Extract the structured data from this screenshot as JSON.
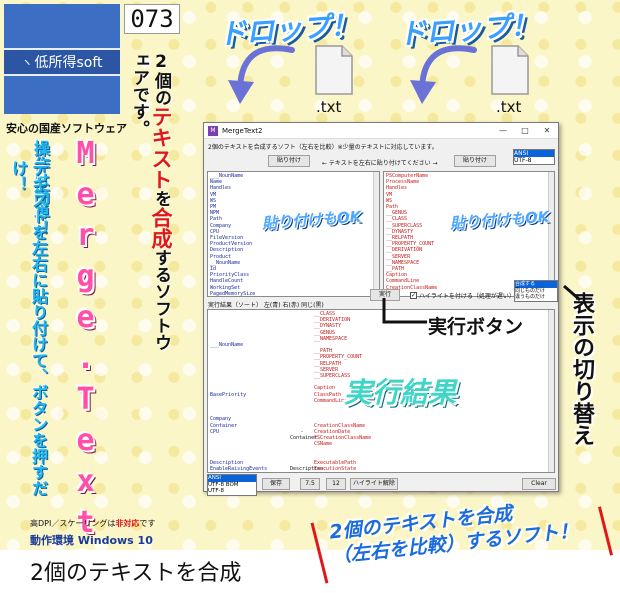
{
  "logo": {
    "mark": "ヽ",
    "name": "低所得soft"
  },
  "tagline": "安心の国産ソフトウェア",
  "number": "073",
  "drop1": "ドロップ！",
  "drop2": "ドロップ！",
  "file1": ".txt",
  "file2": ".txt",
  "vertical": {
    "desc": {
      "p1": "2個の",
      "red1": "テキスト",
      "p2": "を",
      "red2": "合成",
      "p3": "するソフトウェアです。"
    },
    "op1": "操作は簡単！",
    "op2": "テキストを左右に貼り付けて、ボタンを押すだけ！",
    "title": "Merge.Text2",
    "display": "表示の切り替え"
  },
  "hdpi": {
    "pre": "高DPI／スケーリングは",
    "red": "非対応",
    "post": "です"
  },
  "env": "動作環境 Windows 10",
  "bottom_title": "2個のテキストを合成",
  "slogan": {
    "line1": "2個のテキストを合成",
    "line2": "（左右を比較）するソフト！"
  },
  "run_label": "実行ボタン",
  "app": {
    "title": "MergeText2",
    "icon_text": "M",
    "window_buttons": [
      "—",
      "□",
      "✕"
    ],
    "description": "2個のテキストを合成するソフト（左右を比較）※少量のテキストに対応しています。",
    "paste_left": "貼り付け",
    "paste_right": "貼り付け",
    "arrow_note": "← テキストを左右に貼り付けてください →",
    "encoding_top": [
      "ANSI",
      "UTF-8"
    ],
    "left_text": "___NounName\nName\nHandles\nVM\nWS\nPM\nNPM\nPath\nCompany\nCPU\nFileVersion\nProductVersion\nDescription\nProduct\n__NounName\nId\nPriorityClass\nHandleCount\nWorkingSet\nPagedMemorySize",
    "right_text": "PSComputerName\nProcessName\nHandles\nVM\nWS\nPath\n__GENUS\n__CLASS\n__SUPERCLASS\n__DYNASTY\n__RELPATH\n__PROPERTY_COUNT\n__DERIVATION\n__SERVER\n__NAMESPACE\n__PATH\nCaption\nCommandLine\nCreationClassName",
    "paste_ok_left": "貼り付けもOK",
    "paste_ok_right": "貼り付けもOK",
    "result_header": "実行結果（ソート） 左(青) 右(赤) 同じ(黒)",
    "run_button": "実行",
    "highlight_checkbox": "ハイライトを付ける（処理が遅い）",
    "display_options": [
      "合成する",
      "同じものだけ",
      "違うものだけ"
    ],
    "result_left": "\n\n\n\n\n___NounName\n\n\n\n\n\n\n\nBasePriority\n\n\n\nCompany\nContainer\nCPU\n\n\n\n\nDescription\nEnableRaisingEvents\n\n\n\nExitCode\nExitTime\nFileVersion",
    "result_mid": "\n\n\n\n\n\n\n\n\n\n\n\n\n\n\n\n\n\n\n-\nContainer\n\n\n\n\nDescription",
    "result_right": "__CLASS\n__DERIVATION\n__DYNASTY\n__GENUS\n__NAMESPACE\n\n__PATH\n__PROPERTY_COUNT\n__RELPATH\n__SERVER\n__SUPERCLASS\n\nCaption\nClassPath\nCommandLine\n\n\n\nCreationClassName\nCreationDate\nCSCreationClassName\nCSName\n\n\nExecutablePath\nExecutionState",
    "result_big": "実行結果",
    "encoding_bottom": [
      "ANSI",
      "UTF-8 BOM",
      "UTF-8"
    ],
    "btn_save": "保存",
    "btn_75": "7.5",
    "btn_12": "12",
    "btn_highlight_clear": "ハイライト解除",
    "btn_clear": "Clear"
  },
  "colors": {
    "logo_blue": "#3c6fc4",
    "accent_red": "#e01818",
    "title_pink": "#ff4fa8",
    "select_blue": "#0a64d8"
  }
}
